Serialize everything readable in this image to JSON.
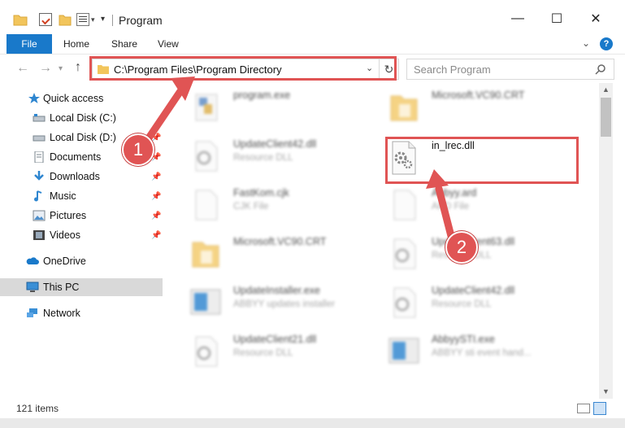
{
  "window": {
    "title": "Program",
    "controls": {
      "minimize": "—",
      "maximize": "☐",
      "close": "✕"
    }
  },
  "ribbon": {
    "file_tab": "File",
    "tabs": [
      "Home",
      "Share",
      "View"
    ],
    "help": "?"
  },
  "navbar": {
    "address": "C:\\Program Files\\Program Directory",
    "search_placeholder": "Search Program"
  },
  "sidebar": {
    "items": [
      {
        "label": "Quick access",
        "icon": "star-icon",
        "pinned": false
      },
      {
        "label": "Local Disk (C:)",
        "icon": "drive-icon",
        "pinned": true
      },
      {
        "label": "Local Disk (D:)",
        "icon": "drive-icon",
        "pinned": true
      },
      {
        "label": "Documents",
        "icon": "documents-icon",
        "pinned": true
      },
      {
        "label": "Downloads",
        "icon": "download-icon",
        "pinned": true
      },
      {
        "label": "Music",
        "icon": "music-icon",
        "pinned": true
      },
      {
        "label": "Pictures",
        "icon": "pictures-icon",
        "pinned": true
      },
      {
        "label": "Videos",
        "icon": "videos-icon",
        "pinned": true
      },
      {
        "label": "OneDrive",
        "icon": "cloud-icon",
        "pinned": false
      },
      {
        "label": "This PC",
        "icon": "computer-icon",
        "pinned": false,
        "selected": true
      },
      {
        "label": "Network",
        "icon": "network-icon",
        "pinned": false
      }
    ]
  },
  "files": {
    "left": [
      {
        "name": "program.exe",
        "desc": "",
        "icon": "exe-icon"
      },
      {
        "name": "UpdateClient42.dll",
        "desc": "Resource DLL",
        "icon": "dll-icon"
      },
      {
        "name": "FastKom.cjk",
        "desc": "CJK File",
        "icon": "file-icon"
      },
      {
        "name": "Microsoft.VC90.CRT",
        "desc": "",
        "icon": "folder-icon"
      },
      {
        "name": "UpdateInstaller.exe",
        "desc": "ABBYY updates installer",
        "icon": "installer-icon"
      },
      {
        "name": "UpdateClient21.dll",
        "desc": "Resource DLL",
        "icon": "dll-icon"
      }
    ],
    "right": [
      {
        "name": "Microsoft.VC90.CRT",
        "desc": "",
        "icon": "folder-icon"
      },
      {
        "name": "in_lrec.dll",
        "desc": "",
        "icon": "dll-gear-icon"
      },
      {
        "name": "Abbyy.ard",
        "desc": "ARD File",
        "icon": "file-icon"
      },
      {
        "name": "UpdateClient63.dll",
        "desc": "Resource DLL",
        "icon": "dll-icon"
      },
      {
        "name": "UpdateClient42.dll",
        "desc": "Resource DLL",
        "icon": "dll-icon"
      },
      {
        "name": "AbbyySTI.exe",
        "desc": "ABBYY sti event hand...",
        "icon": "installer-icon"
      }
    ]
  },
  "status": {
    "count": "121 items"
  },
  "callouts": {
    "one": "1",
    "two": "2"
  },
  "colors": {
    "accent": "#1979ca",
    "highlight": "#e05454",
    "selected": "#d9d9d9",
    "folder": "#f2c55c"
  }
}
